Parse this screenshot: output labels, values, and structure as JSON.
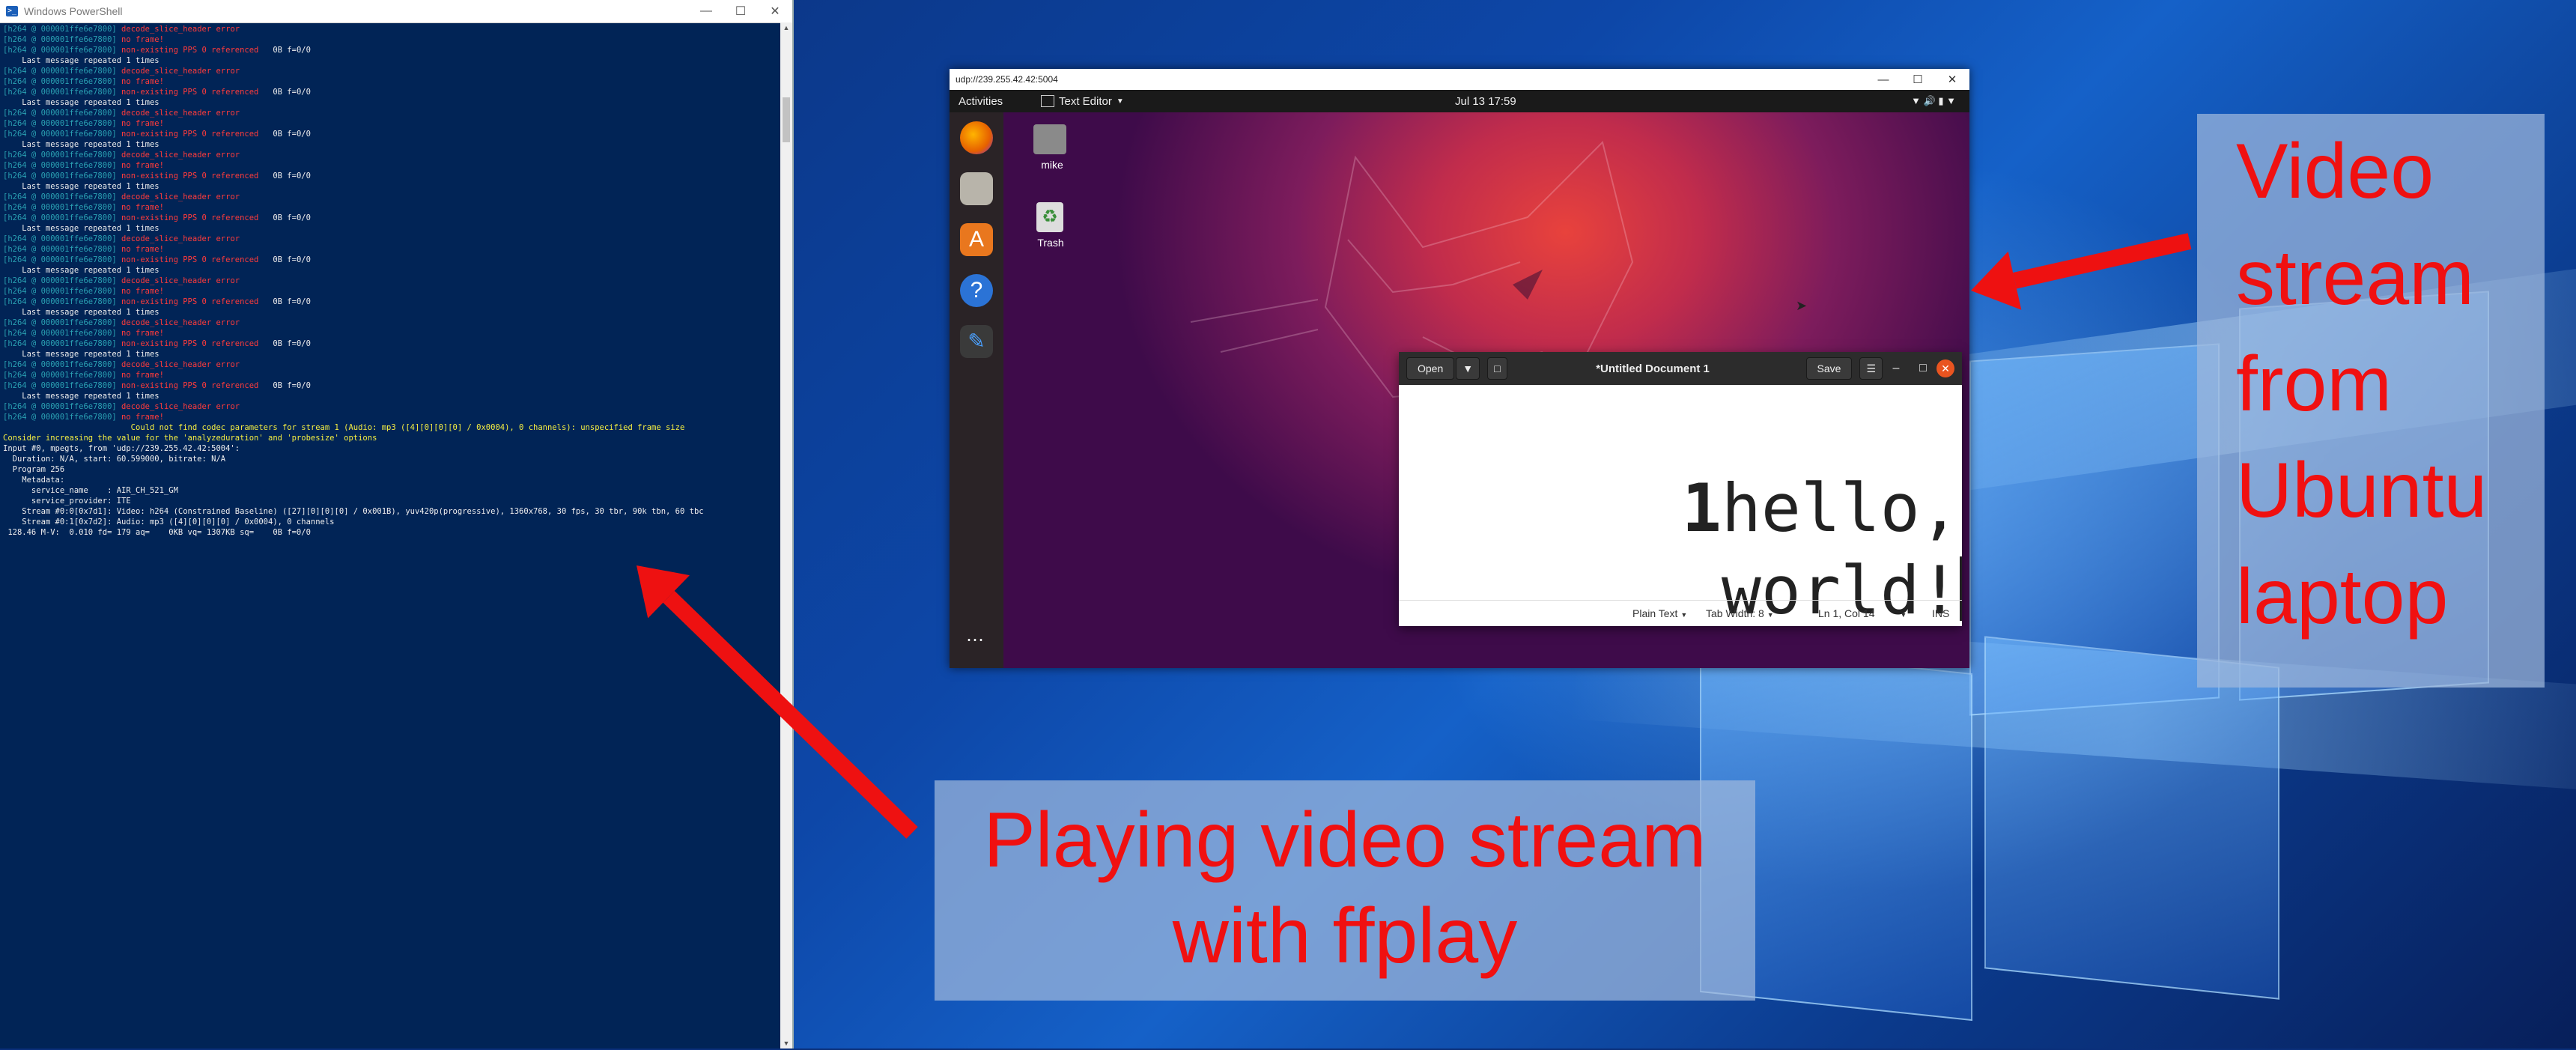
{
  "powershell": {
    "title": "Windows PowerShell",
    "lines": [
      {
        "pre": "[h264 @ 000001ffe6e7800] ",
        "msg": "decode_slice_header error",
        "cls": "err",
        "tail": ""
      },
      {
        "pre": "[h264 @ 000001ffe6e7800] ",
        "msg": "no frame!",
        "cls": "err",
        "tail": ""
      },
      {
        "pre": "[h264 @ 000001ffe6e7800] ",
        "msg": "non-existing PPS 0 referenced",
        "cls": "err",
        "tail": "   0B f=0/0"
      },
      {
        "pre": "",
        "msg": "    Last message repeated 1 times",
        "cls": "",
        "tail": ""
      },
      {
        "pre": "[h264 @ 000001ffe6e7800] ",
        "msg": "decode_slice_header error",
        "cls": "err",
        "tail": ""
      },
      {
        "pre": "[h264 @ 000001ffe6e7800] ",
        "msg": "no frame!",
        "cls": "err",
        "tail": ""
      },
      {
        "pre": "[h264 @ 000001ffe6e7800] ",
        "msg": "non-existing PPS 0 referenced",
        "cls": "err",
        "tail": "   0B f=0/0"
      },
      {
        "pre": "",
        "msg": "    Last message repeated 1 times",
        "cls": "",
        "tail": ""
      },
      {
        "pre": "[h264 @ 000001ffe6e7800] ",
        "msg": "decode_slice_header error",
        "cls": "err",
        "tail": ""
      },
      {
        "pre": "[h264 @ 000001ffe6e7800] ",
        "msg": "no frame!",
        "cls": "err",
        "tail": ""
      },
      {
        "pre": "[h264 @ 000001ffe6e7800] ",
        "msg": "non-existing PPS 0 referenced",
        "cls": "err",
        "tail": "   0B f=0/0"
      },
      {
        "pre": "",
        "msg": "    Last message repeated 1 times",
        "cls": "",
        "tail": ""
      },
      {
        "pre": "[h264 @ 000001ffe6e7800] ",
        "msg": "decode_slice_header error",
        "cls": "err",
        "tail": ""
      },
      {
        "pre": "[h264 @ 000001ffe6e7800] ",
        "msg": "no frame!",
        "cls": "err",
        "tail": ""
      },
      {
        "pre": "[h264 @ 000001ffe6e7800] ",
        "msg": "non-existing PPS 0 referenced",
        "cls": "err",
        "tail": "   0B f=0/0"
      },
      {
        "pre": "",
        "msg": "    Last message repeated 1 times",
        "cls": "",
        "tail": ""
      },
      {
        "pre": "[h264 @ 000001ffe6e7800] ",
        "msg": "decode_slice_header error",
        "cls": "err",
        "tail": ""
      },
      {
        "pre": "[h264 @ 000001ffe6e7800] ",
        "msg": "no frame!",
        "cls": "err",
        "tail": ""
      },
      {
        "pre": "[h264 @ 000001ffe6e7800] ",
        "msg": "non-existing PPS 0 referenced",
        "cls": "err",
        "tail": "   0B f=0/0"
      },
      {
        "pre": "",
        "msg": "    Last message repeated 1 times",
        "cls": "",
        "tail": ""
      },
      {
        "pre": "[h264 @ 000001ffe6e7800] ",
        "msg": "decode_slice_header error",
        "cls": "err",
        "tail": ""
      },
      {
        "pre": "[h264 @ 000001ffe6e7800] ",
        "msg": "no frame!",
        "cls": "err",
        "tail": ""
      },
      {
        "pre": "[h264 @ 000001ffe6e7800] ",
        "msg": "non-existing PPS 0 referenced",
        "cls": "err",
        "tail": "   0B f=0/0"
      },
      {
        "pre": "",
        "msg": "    Last message repeated 1 times",
        "cls": "",
        "tail": ""
      },
      {
        "pre": "[h264 @ 000001ffe6e7800] ",
        "msg": "decode_slice_header error",
        "cls": "err",
        "tail": ""
      },
      {
        "pre": "[h264 @ 000001ffe6e7800] ",
        "msg": "no frame!",
        "cls": "err",
        "tail": ""
      },
      {
        "pre": "[h264 @ 000001ffe6e7800] ",
        "msg": "non-existing PPS 0 referenced",
        "cls": "err",
        "tail": "   0B f=0/0"
      },
      {
        "pre": "",
        "msg": "    Last message repeated 1 times",
        "cls": "",
        "tail": ""
      },
      {
        "pre": "[h264 @ 000001ffe6e7800] ",
        "msg": "decode_slice_header error",
        "cls": "err",
        "tail": ""
      },
      {
        "pre": "[h264 @ 000001ffe6e7800] ",
        "msg": "no frame!",
        "cls": "err",
        "tail": ""
      },
      {
        "pre": "[h264 @ 000001ffe6e7800] ",
        "msg": "non-existing PPS 0 referenced",
        "cls": "err",
        "tail": "   0B f=0/0"
      },
      {
        "pre": "",
        "msg": "    Last message repeated 1 times",
        "cls": "",
        "tail": ""
      },
      {
        "pre": "[h264 @ 000001ffe6e7800] ",
        "msg": "decode_slice_header error",
        "cls": "err",
        "tail": ""
      },
      {
        "pre": "[h264 @ 000001ffe6e7800] ",
        "msg": "no frame!",
        "cls": "err",
        "tail": ""
      },
      {
        "pre": "[h264 @ 000001ffe6e7800] ",
        "msg": "non-existing PPS 0 referenced",
        "cls": "err",
        "tail": "   0B f=0/0"
      },
      {
        "pre": "",
        "msg": "    Last message repeated 1 times",
        "cls": "",
        "tail": ""
      },
      {
        "pre": "[h264 @ 000001ffe6e7800] ",
        "msg": "decode_slice_header error",
        "cls": "err",
        "tail": ""
      },
      {
        "pre": "[h264 @ 000001ffe6e7800] ",
        "msg": "no frame!",
        "cls": "err",
        "tail": ""
      },
      {
        "pre": "",
        "msg": "                           Could not find codec parameters for stream 1 (Audio: mp3 ([4][0][0][0] / 0x0004), 0 channels): unspecified frame size",
        "cls": "yel",
        "tail": ""
      },
      {
        "pre": "",
        "msg": "Consider increasing the value for the 'analyzeduration' and 'probesize' options",
        "cls": "yel",
        "tail": ""
      },
      {
        "pre": "",
        "msg": "Input #0, mpegts, from 'udp://239.255.42.42:5004':",
        "cls": "",
        "tail": ""
      },
      {
        "pre": "",
        "msg": "  Duration: N/A, start: 60.599000, bitrate: N/A",
        "cls": "",
        "tail": ""
      },
      {
        "pre": "",
        "msg": "  Program 256",
        "cls": "",
        "tail": ""
      },
      {
        "pre": "",
        "msg": "    Metadata:",
        "cls": "",
        "tail": ""
      },
      {
        "pre": "",
        "msg": "      service_name    : AIR_CH_521_GM",
        "cls": "",
        "tail": ""
      },
      {
        "pre": "",
        "msg": "      service_provider: ITE",
        "cls": "",
        "tail": ""
      },
      {
        "pre": "",
        "msg": "    Stream #0:0[0x7d1]: Video: h264 (Constrained Baseline) ([27][0][0][0] / 0x001B), yuv420p(progressive), 1360x768, 30 fps, 30 tbr, 90k tbn, 60 tbc",
        "cls": "",
        "tail": ""
      },
      {
        "pre": "",
        "msg": "",
        "cls": "",
        "tail": ""
      },
      {
        "pre": "",
        "msg": "    Stream #0:1[0x7d2]: Audio: mp3 ([4][0][0][0] / 0x0004), 0 channels",
        "cls": "",
        "tail": ""
      },
      {
        "pre": "",
        "msg": " 128.46 M-V:  0.010 fd= 179 aq=    0KB vq= 1307KB sq=    0B f=0/0",
        "cls": "",
        "tail": ""
      }
    ]
  },
  "video_window": {
    "title": "udp://239.255.42.42:5004",
    "topbar": {
      "activities": "Activities",
      "app_menu": "Text Editor",
      "clock": "Jul 13  17:59"
    },
    "desktop_icons": [
      {
        "label": "mike"
      },
      {
        "label": "Trash"
      }
    ]
  },
  "gedit": {
    "title": "*Untitled Document 1",
    "open_label": "Open",
    "save_label": "Save",
    "line1_num": "1",
    "line1": "hello,",
    "line2": " world!",
    "status": {
      "syntax": "Plain Text",
      "tab_width": "Tab Width: 8",
      "position": "Ln 1, Col 14",
      "mode": "INS"
    }
  },
  "annotations": {
    "right": [
      "Video",
      "stream",
      "from",
      "Ubuntu",
      "laptop"
    ],
    "bottom_line1": "Playing video stream",
    "bottom_line2": "with ffplay",
    "arrow_color": "#ee1111"
  }
}
